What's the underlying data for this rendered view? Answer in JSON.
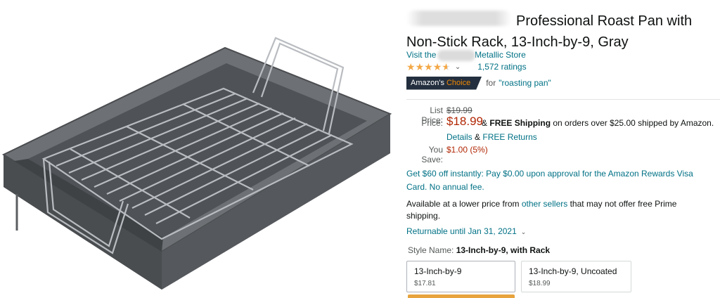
{
  "product": {
    "title": "Professional Roast Pan with Non-Stick Rack, 13-Inch-by-9, Gray",
    "store_prefix": "Visit the",
    "store_suffix": "Metallic Store",
    "rating_stars": 4.5,
    "ratings_count": "1,572 ratings",
    "badge_part1": "Amazon's",
    "badge_part2": "Choice",
    "badge_for": "for",
    "badge_term": "\"roasting pan\""
  },
  "pricing": {
    "list_label": "List Price:",
    "list_price": "$19.99",
    "price_label": "Price:",
    "price": "$18.99",
    "price_amp": "&",
    "free_shipping": "FREE Shipping",
    "shipping_text": "on orders over $25.00 shipped by Amazon.",
    "details": "Details",
    "details_amp": "&",
    "free_returns": "FREE Returns",
    "save_label": "You Save:",
    "save_value": "$1.00 (5%)"
  },
  "promo": "Get $60 off instantly: Pay $0.00 upon approval for the Amazon Rewards Visa Card. No annual fee.",
  "availability": {
    "prefix": "Available at a lower price from",
    "link": "other sellers",
    "suffix": "that may not offer free Prime shipping."
  },
  "returnable": "Returnable until Jan 31, 2021",
  "style": {
    "label": "Style Name:",
    "value": "13-Inch-by-9, with Rack",
    "options": [
      {
        "label": "13-Inch-by-9",
        "price": "$17.81"
      },
      {
        "label": "13-Inch-by-9, Uncoated",
        "price": "$18.99"
      }
    ]
  },
  "colors": {
    "link": "#007185",
    "price": "#b12704",
    "star": "#f3a847",
    "badge_bg": "#232f3e",
    "badge_accent": "#f08804"
  }
}
